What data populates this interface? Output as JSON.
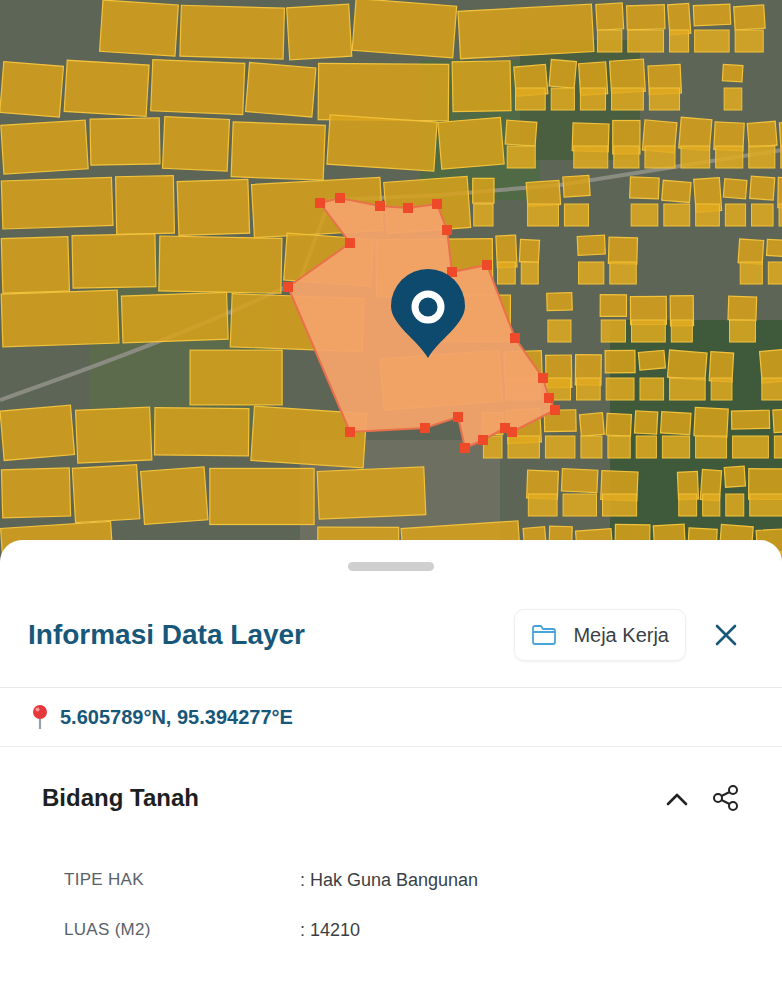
{
  "map": {
    "selected_parcel": {
      "selected": true
    }
  },
  "header": {
    "title": "Informasi Data Layer",
    "workspace_button": "Meja Kerja"
  },
  "location": {
    "coordinates": "5.605789°N, 95.394277°E"
  },
  "section": {
    "title": "Bidang Tanah",
    "expanded": true,
    "fields": [
      {
        "label": "TIPE HAK",
        "value": ": Hak Guna Bangunan"
      },
      {
        "label": "LUAS (M2)",
        "value": ": 14210"
      }
    ]
  }
}
